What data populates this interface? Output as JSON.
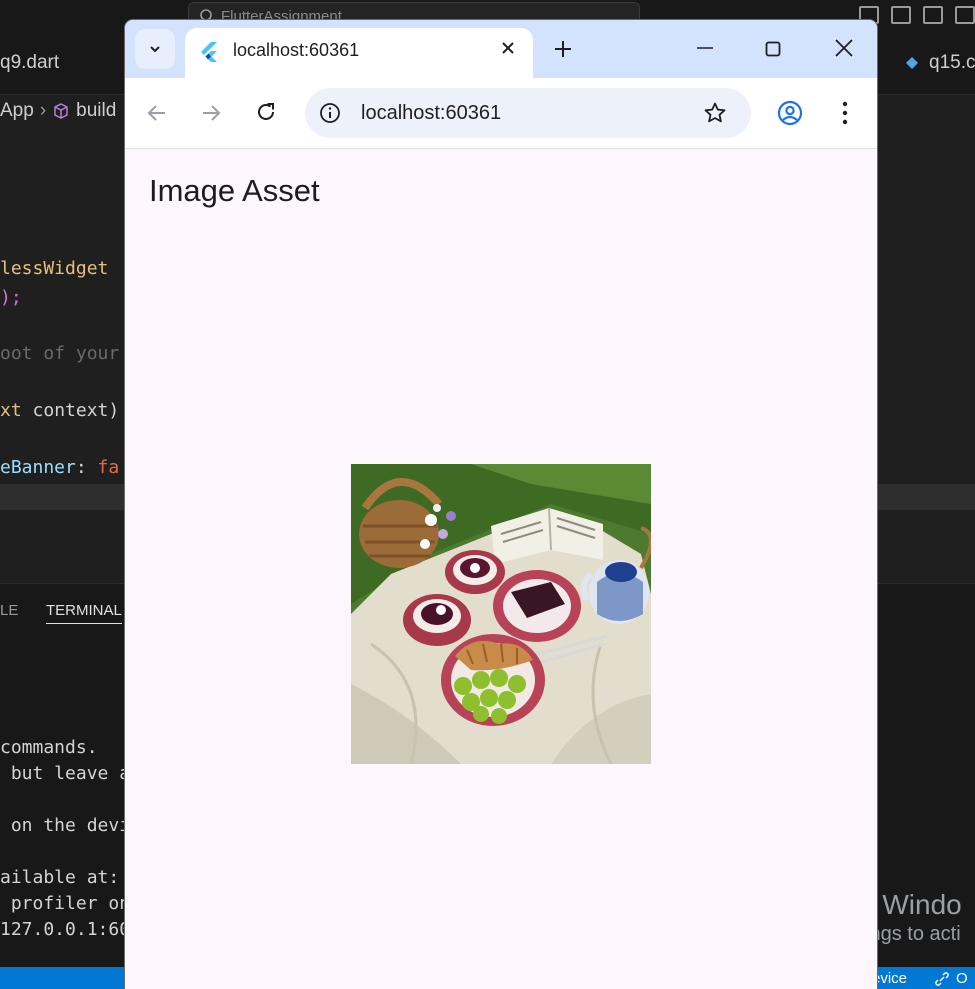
{
  "vscode": {
    "search_text": "FlutterAssignment",
    "tabs": {
      "left": "q9.dart",
      "right": "q15.c"
    },
    "breadcrumb": {
      "item1": "App",
      "item2": "build"
    },
    "code": {
      "line1": "lessWidget",
      "line2": ");",
      "line3": "oot of your",
      "line4a": "xt",
      "line4b": " context)",
      "line5a": "eBanner",
      "line5b": ": ",
      "line5c": "fa"
    },
    "panel": {
      "tab_partial": "LE",
      "tab_terminal": "TERMINAL",
      "lines": [
        "commands.",
        " but leave a",
        " on the devi",
        "ailable at:",
        " profiler on",
        "127.0.0.1:60"
      ]
    },
    "status": {
      "left_partial": "evice",
      "right_partial": "O"
    }
  },
  "watermark": {
    "line1": "Activate Windo",
    "line2": "Go to Settings to acti"
  },
  "browser": {
    "tab_title": "localhost:60361",
    "url": "localhost:60361"
  },
  "app": {
    "title": "Image Asset",
    "image_alt": "Picnic table with tea cups, cake, croissants and green plums on a lawn"
  },
  "colors": {
    "chrome_tabstrip": "#d3e3fd",
    "page_background": "#fdf6fd",
    "vscode_status": "#0078d4"
  }
}
